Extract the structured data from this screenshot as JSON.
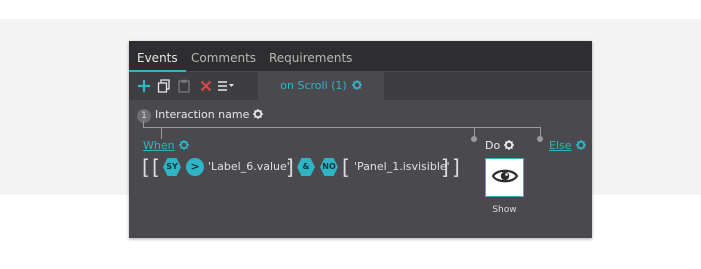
{
  "tabs": [
    {
      "label": "Events",
      "active": true
    },
    {
      "label": "Comments",
      "active": false
    },
    {
      "label": "Requirements",
      "active": false
    }
  ],
  "toolbar": {
    "icons": [
      "plus-icon",
      "copy-icon",
      "paste-icon",
      "delete-icon",
      "list-menu-icon"
    ]
  },
  "interaction_tab": {
    "label": "on Scroll (1)"
  },
  "interaction": {
    "number": "1",
    "name": "Interaction name"
  },
  "condition": {
    "when_label": "When",
    "else_label": "Else",
    "sy_badge": "SY",
    "operator_symbol": ">",
    "left_value": "'Label_6.value'",
    "and_badge": "&",
    "no_badge": "NO",
    "right_value": "'Panel_1.isvisible'"
  },
  "action": {
    "do_label": "Do",
    "name": "Show",
    "icon": "eye-icon"
  },
  "colors": {
    "accent": "#2fb4c6",
    "panel_bg": "#4a4a4e",
    "tabbar_bg": "#2e2e30",
    "toolbar_bg": "#3e3e42",
    "delete_red": "#e0474c"
  }
}
